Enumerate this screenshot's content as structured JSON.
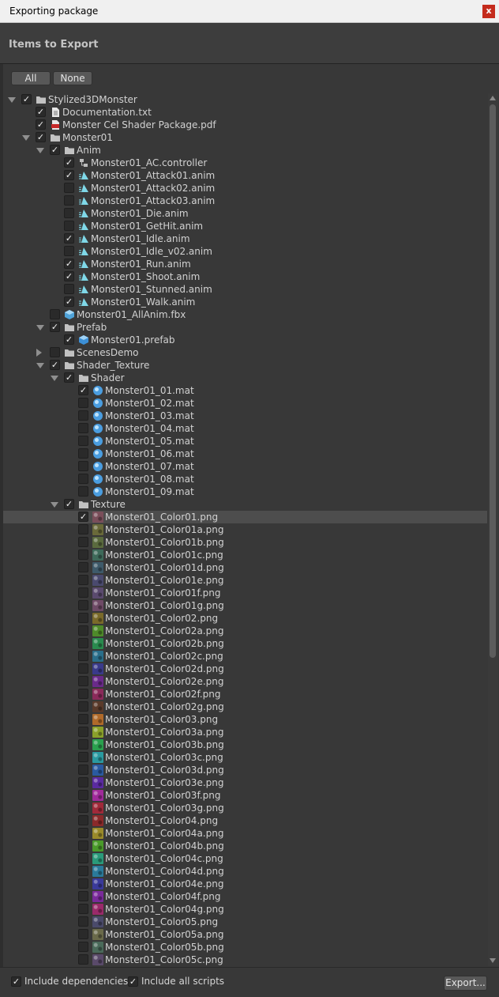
{
  "window": {
    "title": "Exporting package",
    "close_glyph": "x"
  },
  "header": {
    "title": "Items to Export"
  },
  "buttons": {
    "all": "All",
    "none": "None",
    "export": "Export..."
  },
  "footer": {
    "include_dependencies": "Include dependencies",
    "include_dependencies_checked": true,
    "include_scripts": "Include all scripts",
    "include_scripts_checked": true
  },
  "tree": [
    {
      "label": "Stylized3DMonster",
      "depth": 0,
      "icon": "folder",
      "checked": true,
      "expand": "down"
    },
    {
      "label": "Documentation.txt",
      "depth": 1,
      "icon": "text",
      "checked": true,
      "expand": "none"
    },
    {
      "label": "Monster Cel Shader Package.pdf",
      "depth": 1,
      "icon": "pdf",
      "checked": true,
      "expand": "none"
    },
    {
      "label": "Monster01",
      "depth": 1,
      "icon": "folder",
      "checked": true,
      "expand": "down"
    },
    {
      "label": "Anim",
      "depth": 2,
      "icon": "folder",
      "checked": true,
      "expand": "down"
    },
    {
      "label": "Monster01_AC.controller",
      "depth": 3,
      "icon": "controller",
      "checked": true,
      "expand": "none"
    },
    {
      "label": "Monster01_Attack01.anim",
      "depth": 3,
      "icon": "anim",
      "checked": true,
      "expand": "none"
    },
    {
      "label": "Monster01_Attack02.anim",
      "depth": 3,
      "icon": "anim",
      "checked": false,
      "expand": "none"
    },
    {
      "label": "Monster01_Attack03.anim",
      "depth": 3,
      "icon": "anim",
      "checked": false,
      "expand": "none"
    },
    {
      "label": "Monster01_Die.anim",
      "depth": 3,
      "icon": "anim",
      "checked": false,
      "expand": "none"
    },
    {
      "label": "Monster01_GetHit.anim",
      "depth": 3,
      "icon": "anim",
      "checked": false,
      "expand": "none"
    },
    {
      "label": "Monster01_Idle.anim",
      "depth": 3,
      "icon": "anim",
      "checked": true,
      "expand": "none"
    },
    {
      "label": "Monster01_Idle_v02.anim",
      "depth": 3,
      "icon": "anim",
      "checked": false,
      "expand": "none"
    },
    {
      "label": "Monster01_Run.anim",
      "depth": 3,
      "icon": "anim",
      "checked": true,
      "expand": "none"
    },
    {
      "label": "Monster01_Shoot.anim",
      "depth": 3,
      "icon": "anim",
      "checked": true,
      "expand": "none"
    },
    {
      "label": "Monster01_Stunned.anim",
      "depth": 3,
      "icon": "anim",
      "checked": false,
      "expand": "none"
    },
    {
      "label": "Monster01_Walk.anim",
      "depth": 3,
      "icon": "anim",
      "checked": true,
      "expand": "none"
    },
    {
      "label": "Monster01_AllAnim.fbx",
      "depth": 2,
      "icon": "model",
      "checked": false,
      "expand": "none"
    },
    {
      "label": "Prefab",
      "depth": 2,
      "icon": "folder",
      "checked": true,
      "expand": "down"
    },
    {
      "label": "Monster01.prefab",
      "depth": 3,
      "icon": "prefab",
      "checked": true,
      "expand": "none"
    },
    {
      "label": "ScenesDemo",
      "depth": 2,
      "icon": "folder",
      "checked": false,
      "expand": "right"
    },
    {
      "label": "Shader_Texture",
      "depth": 2,
      "icon": "folder",
      "checked": true,
      "expand": "down"
    },
    {
      "label": "Shader",
      "depth": 3,
      "icon": "folder",
      "checked": true,
      "expand": "down"
    },
    {
      "label": "Monster01_01.mat",
      "depth": 4,
      "icon": "material",
      "checked": true,
      "expand": "none"
    },
    {
      "label": "Monster01_02.mat",
      "depth": 4,
      "icon": "material",
      "checked": false,
      "expand": "none"
    },
    {
      "label": "Monster01_03.mat",
      "depth": 4,
      "icon": "material",
      "checked": false,
      "expand": "none"
    },
    {
      "label": "Monster01_04.mat",
      "depth": 4,
      "icon": "material",
      "checked": false,
      "expand": "none"
    },
    {
      "label": "Monster01_05.mat",
      "depth": 4,
      "icon": "material",
      "checked": false,
      "expand": "none"
    },
    {
      "label": "Monster01_06.mat",
      "depth": 4,
      "icon": "material",
      "checked": false,
      "expand": "none"
    },
    {
      "label": "Monster01_07.mat",
      "depth": 4,
      "icon": "material",
      "checked": false,
      "expand": "none"
    },
    {
      "label": "Monster01_08.mat",
      "depth": 4,
      "icon": "material",
      "checked": false,
      "expand": "none"
    },
    {
      "label": "Monster01_09.mat",
      "depth": 4,
      "icon": "material",
      "checked": false,
      "expand": "none"
    },
    {
      "label": "Texture",
      "depth": 3,
      "icon": "folder",
      "checked": true,
      "expand": "down"
    },
    {
      "label": "Monster01_Color01.png",
      "depth": 4,
      "icon": "texture",
      "color": "#7a4e5a",
      "checked": true,
      "expand": "none",
      "selected": true
    },
    {
      "label": "Monster01_Color01a.png",
      "depth": 4,
      "icon": "texture",
      "color": "#6a6a3a",
      "checked": false,
      "expand": "none"
    },
    {
      "label": "Monster01_Color01b.png",
      "depth": 4,
      "icon": "texture",
      "color": "#5a6a3e",
      "checked": false,
      "expand": "none"
    },
    {
      "label": "Monster01_Color01c.png",
      "depth": 4,
      "icon": "texture",
      "color": "#3e6a5a",
      "checked": false,
      "expand": "none"
    },
    {
      "label": "Monster01_Color01d.png",
      "depth": 4,
      "icon": "texture",
      "color": "#3e5a6a",
      "checked": false,
      "expand": "none"
    },
    {
      "label": "Monster01_Color01e.png",
      "depth": 4,
      "icon": "texture",
      "color": "#4a4a6e",
      "checked": false,
      "expand": "none"
    },
    {
      "label": "Monster01_Color01f.png",
      "depth": 4,
      "icon": "texture",
      "color": "#5a4a6e",
      "checked": false,
      "expand": "none"
    },
    {
      "label": "Monster01_Color01g.png",
      "depth": 4,
      "icon": "texture",
      "color": "#6e4a66",
      "checked": false,
      "expand": "none"
    },
    {
      "label": "Monster01_Color02.png",
      "depth": 4,
      "icon": "texture",
      "color": "#7a6a2a",
      "checked": false,
      "expand": "none"
    },
    {
      "label": "Monster01_Color02a.png",
      "depth": 4,
      "icon": "texture",
      "color": "#4e8a2a",
      "checked": false,
      "expand": "none"
    },
    {
      "label": "Monster01_Color02b.png",
      "depth": 4,
      "icon": "texture",
      "color": "#2a8a4e",
      "checked": false,
      "expand": "none"
    },
    {
      "label": "Monster01_Color02c.png",
      "depth": 4,
      "icon": "texture",
      "color": "#2a6e8a",
      "checked": false,
      "expand": "none"
    },
    {
      "label": "Monster01_Color02d.png",
      "depth": 4,
      "icon": "texture",
      "color": "#3a3a8a",
      "checked": false,
      "expand": "none"
    },
    {
      "label": "Monster01_Color02e.png",
      "depth": 4,
      "icon": "texture",
      "color": "#6a2a8a",
      "checked": false,
      "expand": "none"
    },
    {
      "label": "Monster01_Color02f.png",
      "depth": 4,
      "icon": "texture",
      "color": "#8a2a5a",
      "checked": false,
      "expand": "none"
    },
    {
      "label": "Monster01_Color02g.png",
      "depth": 4,
      "icon": "texture",
      "color": "#5a3a2a",
      "checked": false,
      "expand": "none"
    },
    {
      "label": "Monster01_Color03.png",
      "depth": 4,
      "icon": "texture",
      "color": "#b06a2a",
      "checked": false,
      "expand": "none"
    },
    {
      "label": "Monster01_Color03a.png",
      "depth": 4,
      "icon": "texture",
      "color": "#8aa02a",
      "checked": false,
      "expand": "none"
    },
    {
      "label": "Monster01_Color03b.png",
      "depth": 4,
      "icon": "texture",
      "color": "#2aa04e",
      "checked": false,
      "expand": "none"
    },
    {
      "label": "Monster01_Color03c.png",
      "depth": 4,
      "icon": "texture",
      "color": "#2a9aa0",
      "checked": false,
      "expand": "none"
    },
    {
      "label": "Monster01_Color03d.png",
      "depth": 4,
      "icon": "texture",
      "color": "#2a5aa0",
      "checked": false,
      "expand": "none"
    },
    {
      "label": "Monster01_Color03e.png",
      "depth": 4,
      "icon": "texture",
      "color": "#5a2aa0",
      "checked": false,
      "expand": "none"
    },
    {
      "label": "Monster01_Color03f.png",
      "depth": 4,
      "icon": "texture",
      "color": "#a02a9a",
      "checked": false,
      "expand": "none"
    },
    {
      "label": "Monster01_Color03g.png",
      "depth": 4,
      "icon": "texture",
      "color": "#a02a3a",
      "checked": false,
      "expand": "none"
    },
    {
      "label": "Monster01_Color04.png",
      "depth": 4,
      "icon": "texture",
      "color": "#8a2a2a",
      "checked": false,
      "expand": "none"
    },
    {
      "label": "Monster01_Color04a.png",
      "depth": 4,
      "icon": "texture",
      "color": "#9a8a2a",
      "checked": false,
      "expand": "none"
    },
    {
      "label": "Monster01_Color04b.png",
      "depth": 4,
      "icon": "texture",
      "color": "#4a9a2a",
      "checked": false,
      "expand": "none"
    },
    {
      "label": "Monster01_Color04c.png",
      "depth": 4,
      "icon": "texture",
      "color": "#2a9a7a",
      "checked": false,
      "expand": "none"
    },
    {
      "label": "Monster01_Color04d.png",
      "depth": 4,
      "icon": "texture",
      "color": "#2a7a9a",
      "checked": false,
      "expand": "none"
    },
    {
      "label": "Monster01_Color04e.png",
      "depth": 4,
      "icon": "texture",
      "color": "#3a3a9a",
      "checked": false,
      "expand": "none"
    },
    {
      "label": "Monster01_Color04f.png",
      "depth": 4,
      "icon": "texture",
      "color": "#7a2a9a",
      "checked": false,
      "expand": "none"
    },
    {
      "label": "Monster01_Color04g.png",
      "depth": 4,
      "icon": "texture",
      "color": "#9a2a6a",
      "checked": false,
      "expand": "none"
    },
    {
      "label": "Monster01_Color05.png",
      "depth": 4,
      "icon": "texture",
      "color": "#4a4a6a",
      "checked": false,
      "expand": "none"
    },
    {
      "label": "Monster01_Color05a.png",
      "depth": 4,
      "icon": "texture",
      "color": "#6a6a4a",
      "checked": false,
      "expand": "none"
    },
    {
      "label": "Monster01_Color05b.png",
      "depth": 4,
      "icon": "texture",
      "color": "#4a6a5a",
      "checked": false,
      "expand": "none"
    },
    {
      "label": "Monster01_Color05c.png",
      "depth": 4,
      "icon": "texture",
      "color": "#5a4a6a",
      "checked": false,
      "expand": "none"
    }
  ]
}
